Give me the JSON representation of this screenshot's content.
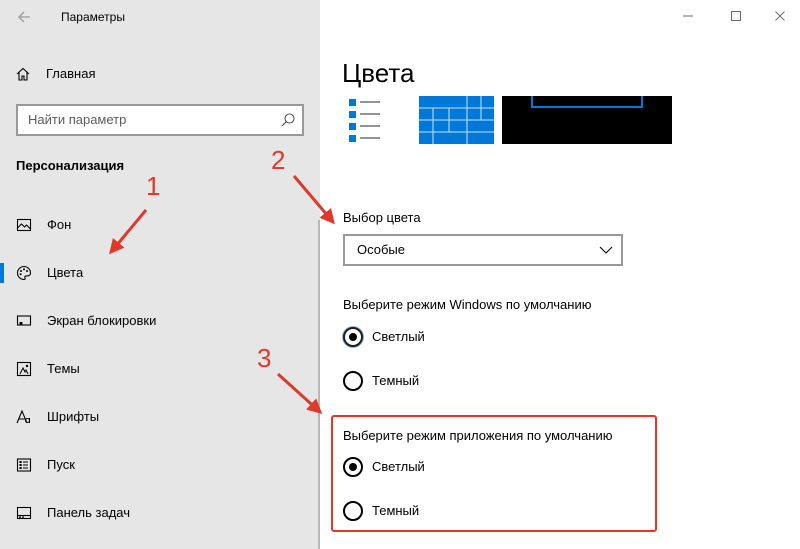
{
  "window": {
    "title": "Параметры",
    "controls": {
      "minimize": "—",
      "maximize": "☐",
      "close": "✕"
    }
  },
  "sidebar": {
    "back_icon": "back-arrow-icon",
    "home": {
      "label": "Главная",
      "icon": "home-icon"
    },
    "search": {
      "placeholder": "Найти параметр",
      "icon": "search-icon"
    },
    "section_title": "Персонализация",
    "items": [
      {
        "label": "Фон",
        "icon": "picture-icon",
        "active": false
      },
      {
        "label": "Цвета",
        "icon": "palette-icon",
        "active": true
      },
      {
        "label": "Экран блокировки",
        "icon": "lock-screen-icon",
        "active": false
      },
      {
        "label": "Темы",
        "icon": "themes-icon",
        "active": false
      },
      {
        "label": "Шрифты",
        "icon": "fonts-icon",
        "active": false
      },
      {
        "label": "Пуск",
        "icon": "start-icon",
        "active": false
      },
      {
        "label": "Панель задач",
        "icon": "taskbar-icon",
        "active": false
      }
    ]
  },
  "main": {
    "title": "Цвета",
    "color_choice": {
      "label": "Выбор цвета",
      "selected": "Особые"
    },
    "windows_mode": {
      "label": "Выберите режим Windows по умолчанию",
      "options": [
        "Светлый",
        "Темный"
      ],
      "selected": "Светлый"
    },
    "app_mode": {
      "label": "Выберите режим приложения по умолчанию",
      "options": [
        "Светлый",
        "Темный"
      ],
      "selected": "Светлый"
    }
  },
  "annotations": {
    "numbers": [
      "1",
      "2",
      "3"
    ],
    "color": "#e0382b"
  },
  "colors": {
    "accent": "#0078d7",
    "sidebar_bg": "#e6e6e6",
    "annotation": "#e0382b"
  }
}
